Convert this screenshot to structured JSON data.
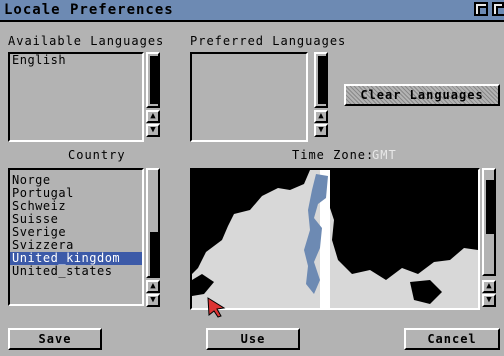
{
  "window": {
    "title": "Locale Preferences"
  },
  "available": {
    "label": "Available Languages",
    "items": [
      "English"
    ]
  },
  "preferred": {
    "label": "Preferred Languages",
    "items": []
  },
  "clear_button": "Clear Languages",
  "country": {
    "label": "Country",
    "items": [
      "Norge",
      "Portugal",
      "Schweiz",
      "Suisse",
      "Sverige",
      "Svizzera",
      "United_kingdom",
      "United_states"
    ],
    "selected": "United_kingdom"
  },
  "timezone": {
    "label": "Time Zone:",
    "value": "GMT"
  },
  "buttons": {
    "save": "Save",
    "use": "Use",
    "cancel": "Cancel"
  },
  "colors": {
    "titlebar": "#6d8ab3",
    "selection": "#3c5aa8",
    "map_water": "#6d8ab3",
    "background": "#b3b3b3"
  }
}
